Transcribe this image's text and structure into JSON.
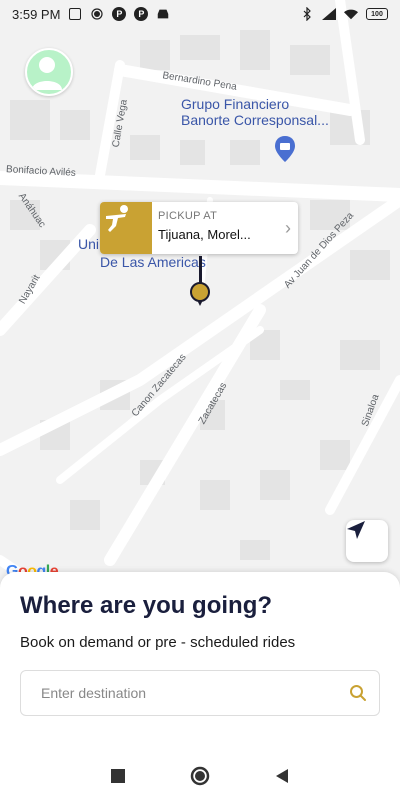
{
  "status_bar": {
    "time": "3:59 PM",
    "battery_level": "100",
    "icons": [
      "upload-icon",
      "gps-icon",
      "parking-icon",
      "parking-icon",
      "car-icon",
      "bluetooth-icon",
      "signal-icon",
      "wifi-icon",
      "battery-icon"
    ]
  },
  "map": {
    "street_labels": {
      "bernardino": "Bernardino Pena",
      "calle_vega": "Calle Vega",
      "bonifacio": "Bonifacio Avilés",
      "anahuac": "Anáhuac",
      "nayarit": "Nayarit",
      "juan_de_dios": "Av Juan de Dios Peza",
      "canon_zacatecas": "Canon Zacatecas",
      "zacatecas": "Zacatecas",
      "sinaloa": "Sinaloa"
    },
    "poi": {
      "line1": "Grupo Financiero",
      "line2": "Banorte Corresponsal..."
    },
    "place": {
      "line1": "Uni",
      "line2": "De Las Americas"
    },
    "google_logo": "Google"
  },
  "pickup": {
    "label": "PICKUP AT",
    "address": "Tijuana, Morel...",
    "accent": "#c9a233"
  },
  "sheet": {
    "title": "Where are you going?",
    "subtitle": "Book on demand or pre - scheduled rides",
    "destination_placeholder": "Enter destination"
  },
  "colors": {
    "title": "#1a1f3d",
    "accent": "#c9a233",
    "map_bg": "#f2f2f2"
  }
}
